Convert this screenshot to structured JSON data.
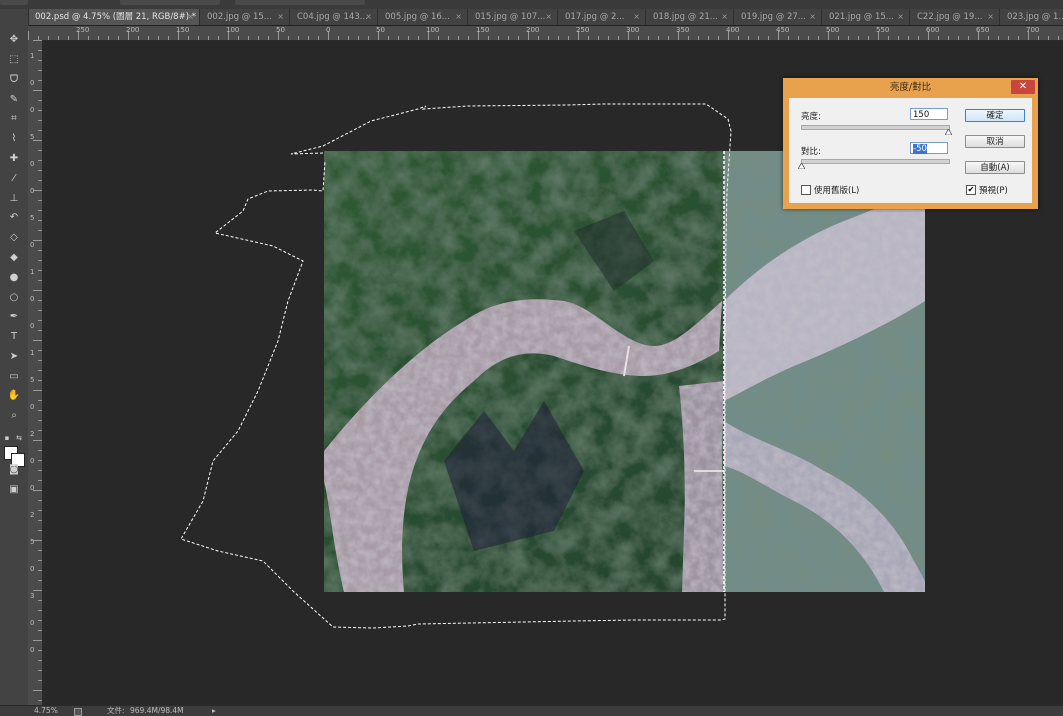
{
  "tabs": [
    {
      "label": "002.psd @ 4.75% (圖層 21, RGB/8#) *",
      "active": true
    },
    {
      "label": "002.jpg @ 15...",
      "active": false
    },
    {
      "label": "C04.jpg @ 143...",
      "active": false
    },
    {
      "label": "005.jpg @ 16...",
      "active": false
    },
    {
      "label": "015.jpg @ 107...",
      "active": false
    },
    {
      "label": "017.jpg @ 2...",
      "active": false
    },
    {
      "label": "018.jpg @ 21...",
      "active": false
    },
    {
      "label": "019.jpg @ 27...",
      "active": false
    },
    {
      "label": "021.jpg @ 15...",
      "active": false
    },
    {
      "label": "C22.jpg @ 19...",
      "active": false
    },
    {
      "label": "023.jpg @ 1...",
      "active": false
    }
  ],
  "tab_close_glyph": "×",
  "ruler": {
    "h_labels": [
      "250",
      "200",
      "150",
      "100",
      "50",
      "0",
      "50",
      "100",
      "150",
      "200",
      "250",
      "300",
      "350",
      "400",
      "450",
      "500",
      "550",
      "600",
      "650",
      "700"
    ],
    "v_labels": [
      "1",
      "0",
      "0",
      "5",
      "0",
      "0",
      "5",
      "0",
      "1",
      "0",
      "0",
      "1",
      "5",
      "0",
      "2",
      "0",
      "0",
      "2",
      "5",
      "0",
      "3",
      "0",
      "0"
    ]
  },
  "tools": [
    {
      "name": "move-tool-icon",
      "glyph": "✥"
    },
    {
      "name": "marquee-tool-icon",
      "glyph": "⬚"
    },
    {
      "name": "lasso-tool-icon",
      "glyph": "ᗜ"
    },
    {
      "name": "quick-select-tool-icon",
      "glyph": "✎"
    },
    {
      "name": "crop-tool-icon",
      "glyph": "⌗"
    },
    {
      "name": "eyedropper-tool-icon",
      "glyph": "⌇"
    },
    {
      "name": "healing-brush-tool-icon",
      "glyph": "✚"
    },
    {
      "name": "brush-tool-icon",
      "glyph": "⁄"
    },
    {
      "name": "clone-stamp-tool-icon",
      "glyph": "⊥"
    },
    {
      "name": "history-brush-tool-icon",
      "glyph": "↶"
    },
    {
      "name": "eraser-tool-icon",
      "glyph": "◇"
    },
    {
      "name": "paint-bucket-tool-icon",
      "glyph": "◆"
    },
    {
      "name": "blur-tool-icon",
      "glyph": "●"
    },
    {
      "name": "dodge-tool-icon",
      "glyph": "○"
    },
    {
      "name": "pen-tool-icon",
      "glyph": "✒"
    },
    {
      "name": "type-tool-icon",
      "glyph": "T"
    },
    {
      "name": "path-select-tool-icon",
      "glyph": "➤"
    },
    {
      "name": "rectangle-tool-icon",
      "glyph": "▭"
    },
    {
      "name": "hand-tool-icon",
      "glyph": "✋"
    },
    {
      "name": "zoom-tool-icon",
      "glyph": "⌕"
    }
  ],
  "extra_tools": [
    {
      "name": "quick-mask-icon",
      "glyph": "◙"
    },
    {
      "name": "screen-mode-icon",
      "glyph": "▣"
    }
  ],
  "status": {
    "zoom": "4.75%",
    "doc_label": "文件:",
    "doc_size": "969.4M/98.4M",
    "arrow": "▸"
  },
  "dialog": {
    "title": "亮度/對比",
    "close_glyph": "✕",
    "brightness_label": "亮度:",
    "brightness_value": "150",
    "contrast_label": "對比:",
    "contrast_value": "-50",
    "brightness_level": 150,
    "contrast_level": -50,
    "ok_label": "確定",
    "cancel_label": "取消",
    "auto_label": "自動(A)",
    "legacy_label": "使用舊版(L)",
    "legacy_checked": false,
    "preview_label": "預視(P)",
    "preview_checked": true,
    "check_glyph": "✔"
  },
  "colors": {
    "dialog_frame": "#e8a14d",
    "close_button": "#c7463d",
    "selection_highlight": "#3b74d8",
    "workspace": "#282828",
    "panel": "#434343"
  }
}
